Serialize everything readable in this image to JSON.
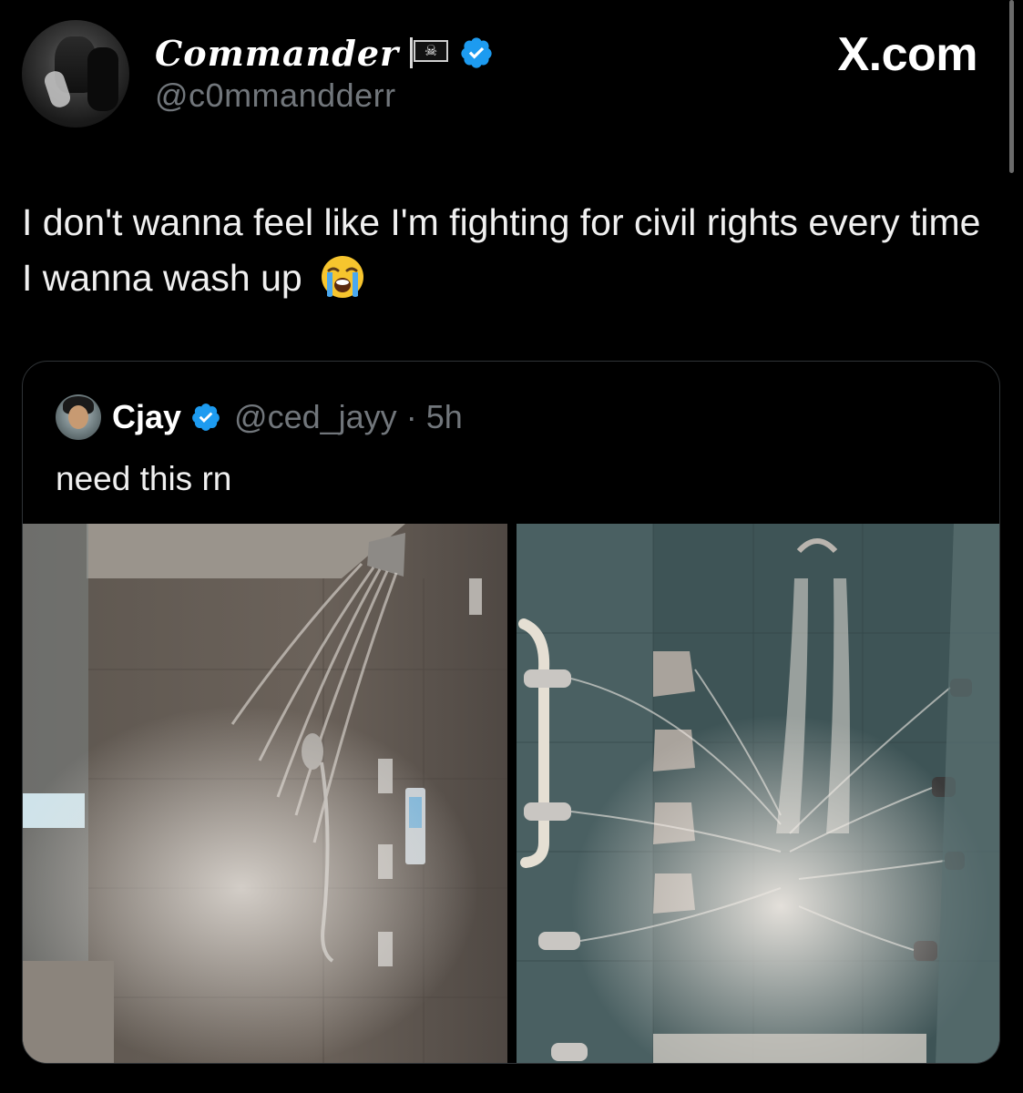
{
  "author": {
    "display_name": "Commander",
    "flag_emoji": "🏴‍☠️",
    "handle": "@c0mmandderr",
    "verified": true
  },
  "brand": {
    "label": "X.com"
  },
  "tweet": {
    "text": "I don't wanna feel like I'm fighting for civil rights every time I wanna wash up",
    "emoji": "😭"
  },
  "quoted_tweet": {
    "name": "Cjay",
    "verified": true,
    "handle": "@ced_jayy",
    "separator": "·",
    "time": "5h",
    "text": "need this rn",
    "media": [
      {
        "icon": "shower-photo-left"
      },
      {
        "icon": "shower-photo-right"
      }
    ]
  },
  "colors": {
    "background": "#000000",
    "text_primary": "#e7e9ea",
    "text_secondary": "#71767b",
    "verified_blue": "#1d9bf0",
    "card_border": "#2f3336"
  }
}
